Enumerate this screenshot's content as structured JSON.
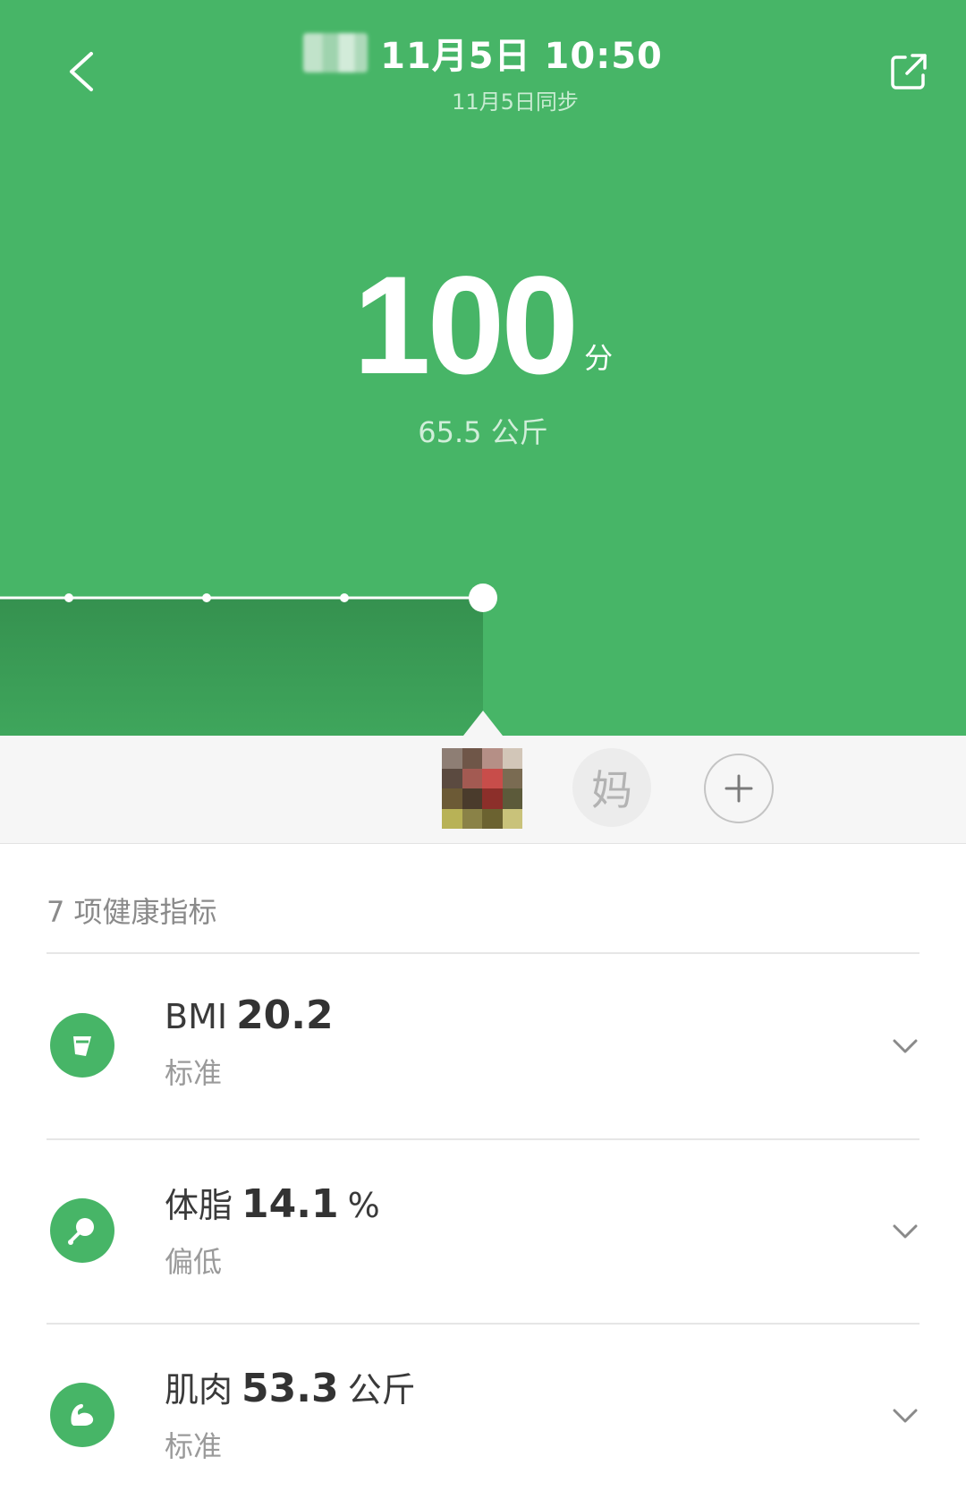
{
  "header": {
    "title_time": "11月5日 10:50",
    "subtitle": "11月5日同步"
  },
  "score": {
    "value": "100",
    "unit": "分",
    "weight": "65.5 公斤"
  },
  "users": {
    "second_user_initial": "妈"
  },
  "metrics": {
    "section_title": "7 项健康指标",
    "items": [
      {
        "label": "BMI",
        "value": "20.2",
        "unit": "",
        "status": "标准",
        "icon": "bmi-icon"
      },
      {
        "label": "体脂",
        "value": "14.1",
        "unit": "%",
        "status": "偏低",
        "icon": "body-fat-icon"
      },
      {
        "label": "肌肉",
        "value": "53.3",
        "unit": "公斤",
        "status": "标准",
        "icon": "muscle-icon"
      }
    ]
  },
  "colors": {
    "accent": "#47b567",
    "accent_dark": "#3a9a55"
  }
}
